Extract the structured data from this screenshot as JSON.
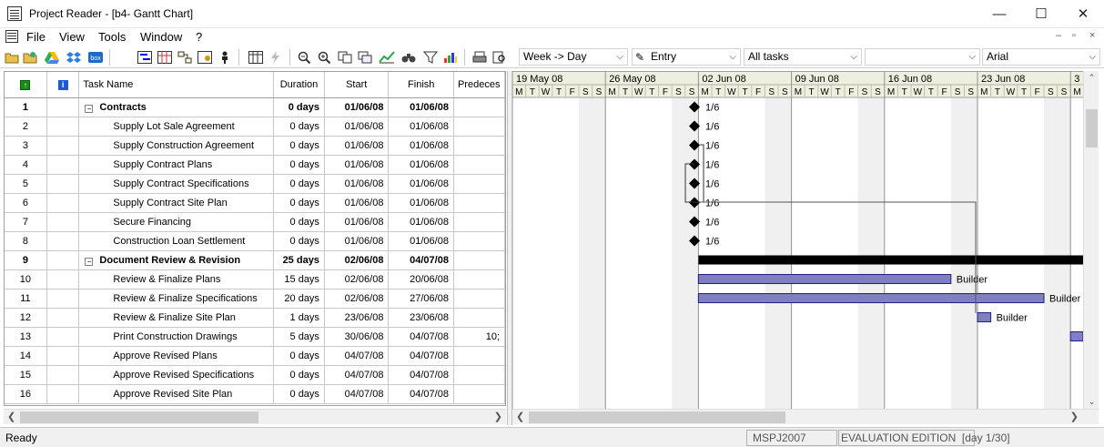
{
  "window": {
    "title": "Project Reader - [b4- Gantt Chart]",
    "controls": [
      "minimize-icon",
      "maximize-icon",
      "close-icon"
    ]
  },
  "menu": {
    "items": [
      "File",
      "View",
      "Tools",
      "Window",
      "?"
    ],
    "mdi_controls": [
      "–",
      "▫",
      "×"
    ]
  },
  "toolbar": {
    "combos": [
      {
        "name": "timescale-select",
        "value": "Week -> Day"
      },
      {
        "name": "table-select",
        "value": "Entry"
      },
      {
        "name": "filter-select",
        "value": "All tasks"
      },
      {
        "name": "group-select",
        "value": ""
      },
      {
        "name": "font-select",
        "value": "Arial"
      }
    ]
  },
  "table": {
    "columns": [
      "",
      "",
      "Task Name",
      "Duration",
      "Start",
      "Finish",
      "Predeces"
    ],
    "rows": [
      {
        "id": "1",
        "name": "Contracts",
        "duration": "0 days",
        "start": "01/06/08",
        "finish": "01/06/08",
        "pred": "",
        "summary": true
      },
      {
        "id": "2",
        "name": "Supply Lot Sale Agreement",
        "duration": "0 days",
        "start": "01/06/08",
        "finish": "01/06/08",
        "pred": "",
        "summary": false
      },
      {
        "id": "3",
        "name": "Supply Construction Agreement",
        "duration": "0 days",
        "start": "01/06/08",
        "finish": "01/06/08",
        "pred": "",
        "summary": false
      },
      {
        "id": "4",
        "name": "Supply Contract Plans",
        "duration": "0 days",
        "start": "01/06/08",
        "finish": "01/06/08",
        "pred": "",
        "summary": false
      },
      {
        "id": "5",
        "name": "Supply Contract Specifications",
        "duration": "0 days",
        "start": "01/06/08",
        "finish": "01/06/08",
        "pred": "",
        "summary": false
      },
      {
        "id": "6",
        "name": "Supply Contract Site Plan",
        "duration": "0 days",
        "start": "01/06/08",
        "finish": "01/06/08",
        "pred": "",
        "summary": false
      },
      {
        "id": "7",
        "name": "Secure Financing",
        "duration": "0 days",
        "start": "01/06/08",
        "finish": "01/06/08",
        "pred": "",
        "summary": false
      },
      {
        "id": "8",
        "name": "Construction Loan Settlement",
        "duration": "0 days",
        "start": "01/06/08",
        "finish": "01/06/08",
        "pred": "",
        "summary": false
      },
      {
        "id": "9",
        "name": "Document Review & Revision",
        "duration": "25 days",
        "start": "02/06/08",
        "finish": "04/07/08",
        "pred": "",
        "summary": true
      },
      {
        "id": "10",
        "name": "Review & Finalize Plans",
        "duration": "15 days",
        "start": "02/06/08",
        "finish": "20/06/08",
        "pred": "",
        "summary": false
      },
      {
        "id": "11",
        "name": "Review & Finalize Specifications",
        "duration": "20 days",
        "start": "02/06/08",
        "finish": "27/06/08",
        "pred": "",
        "summary": false
      },
      {
        "id": "12",
        "name": "Review & Finalize Site Plan",
        "duration": "1 days",
        "start": "23/06/08",
        "finish": "23/06/08",
        "pred": "",
        "summary": false
      },
      {
        "id": "13",
        "name": "Print Construction Drawings",
        "duration": "5 days",
        "start": "30/06/08",
        "finish": "04/07/08",
        "pred": "10;",
        "summary": false
      },
      {
        "id": "14",
        "name": "Approve Revised Plans",
        "duration": "0 days",
        "start": "04/07/08",
        "finish": "04/07/08",
        "pred": "",
        "summary": false
      },
      {
        "id": "15",
        "name": "Approve Revised Specifications",
        "duration": "0 days",
        "start": "04/07/08",
        "finish": "04/07/08",
        "pred": "",
        "summary": false
      },
      {
        "id": "16",
        "name": "Approve Revised Site Plan",
        "duration": "0 days",
        "start": "04/07/08",
        "finish": "04/07/08",
        "pred": "",
        "summary": false
      }
    ]
  },
  "gantt": {
    "weeks": [
      "19 May 08",
      "26 May 08",
      "02 Jun 08",
      "09 Jun 08",
      "16 Jun 08",
      "23 Jun 08",
      "3"
    ],
    "day_letters": [
      "M",
      "T",
      "W",
      "T",
      "F",
      "S",
      "S"
    ],
    "milestone_label": "1/6",
    "resource_label": "Builder",
    "bar_color": "#8080c0",
    "summary_color": "#000000",
    "weekend_shade": "#f0f0f0"
  },
  "status": {
    "left": "Ready",
    "panels": [
      "MSPJ2007",
      "EVALUATION EDITION  [day 1/30]"
    ]
  }
}
